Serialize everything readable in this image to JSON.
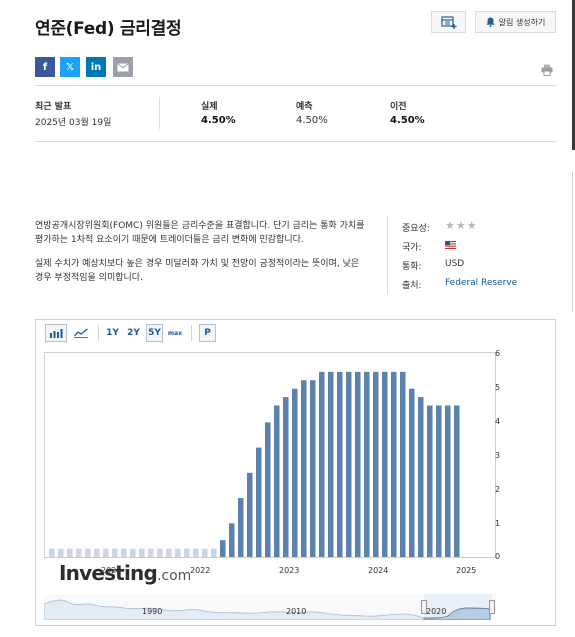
{
  "header": {
    "title": "연준(Fed) 금리결정",
    "alert_button": "알림 생성하기"
  },
  "share": {
    "facebook": "f",
    "twitter": "𝕏",
    "linkedin": "in"
  },
  "stats": {
    "latest_release_label": "최근 발표",
    "latest_release_date": "2025년 03월 19일",
    "actual_label": "실제",
    "actual_value": "4.50%",
    "forecast_label": "예측",
    "forecast_value": "4.50%",
    "previous_label": "이전",
    "previous_value": "4.50%"
  },
  "description": {
    "para1": "연방공개시장위원회(FOMC) 위원들은 금리수준을 표결합니다. 단기 금리는 통화 가치를 평가하는 1차적 요소이기 때문에 트레이더들은 금리 변화에 민감합니다.",
    "para2": "실제 수치가 예상치보다 높은 경우 미달러화 가치 및 전망이 긍정적이라는 뜻이며, 낮은 경우 부정적임을 의미합니다."
  },
  "meta": {
    "importance_label": "중요성:",
    "importance_stars": 3,
    "country_label": "국가:",
    "currency_label": "통화:",
    "currency_value": "USD",
    "source_label": "출처:",
    "source_value": "Federal Reserve"
  },
  "chart_toolbar": {
    "range_1y": "1Y",
    "range_2y": "2Y",
    "range_5y": "5Y",
    "range_max": "max",
    "range_selected": "5Y",
    "p_button": "P"
  },
  "watermark": {
    "brand": "Investing",
    "suffix": ".com"
  },
  "navigator_labels": [
    "1990",
    "2010",
    "2020"
  ],
  "colors": {
    "bar": "#5b82ad",
    "accent": "#1256a0"
  },
  "chart_data": {
    "type": "bar",
    "x_tick_labels": [
      "2021",
      "2022",
      "2023",
      "2024",
      "2025"
    ],
    "y_tick_labels": [
      "0",
      "1",
      "2",
      "3",
      "4",
      "5",
      "6"
    ],
    "ylim": [
      0,
      6
    ],
    "series": [
      {
        "values": [
          0.25,
          0.25,
          0.25,
          0.25,
          0.25,
          0.25,
          0.25,
          0.25,
          0.25,
          0.25,
          0.25,
          0.25,
          0.25,
          0.25,
          0.25,
          0.25,
          0.25,
          0.25,
          0.25,
          0.5,
          1.0,
          1.75,
          2.5,
          3.25,
          4.0,
          4.5,
          4.75,
          5.0,
          5.25,
          5.25,
          5.5,
          5.5,
          5.5,
          5.5,
          5.5,
          5.5,
          5.5,
          5.5,
          5.5,
          5.5,
          5.0,
          4.75,
          4.5,
          4.5,
          4.5,
          4.5
        ]
      }
    ],
    "x_ticks": [
      {
        "label": "2021",
        "index": 6
      },
      {
        "label": "2022",
        "index": 16.5
      },
      {
        "label": "2023",
        "index": 26.5
      },
      {
        "label": "2024",
        "index": 36.5
      },
      {
        "label": "2025",
        "index": 46.5
      }
    ]
  }
}
